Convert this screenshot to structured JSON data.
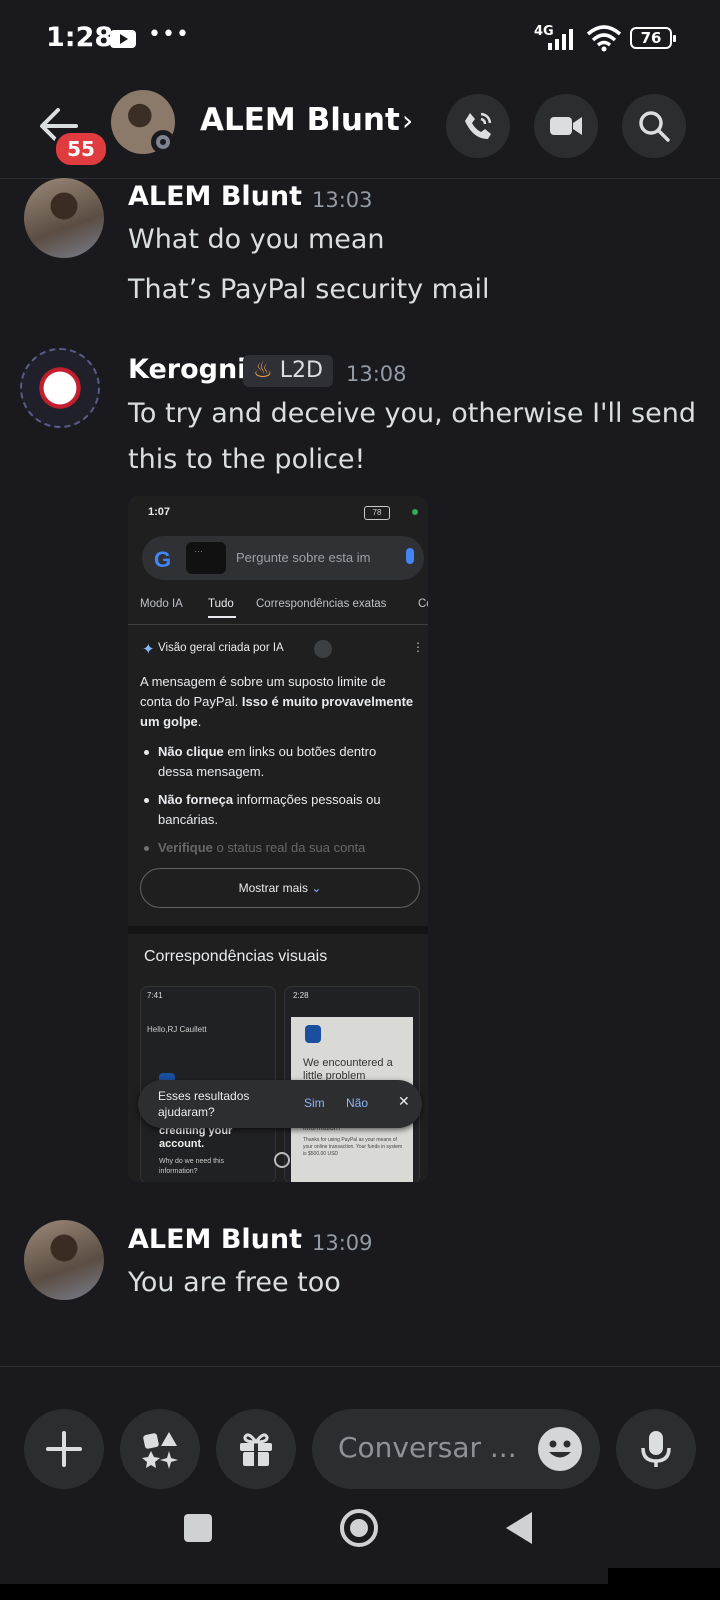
{
  "status_bar": {
    "time": "1:28",
    "dots": "•••",
    "network": "4G",
    "battery": "76"
  },
  "header": {
    "unread_badge": "55",
    "contact_name": "ALEM Blunt",
    "chevron": "›"
  },
  "messages": [
    {
      "author": "ALEM Blunt",
      "time": "13:03",
      "lines": [
        "What do you mean",
        "That’s PayPal security mail"
      ]
    },
    {
      "author": "Kerogni",
      "tag": "L2D",
      "time": "13:08",
      "lines": [
        "To try and deceive you, otherwise I'll send",
        "this to the police!"
      ]
    },
    {
      "author": "ALEM Blunt",
      "time": "13:09",
      "lines": [
        "You are free too"
      ]
    }
  ],
  "attachment": {
    "status_time": "1:07",
    "status_battery": "78",
    "thumb_text": "…",
    "search_placeholder": "Pergunte sobre esta im",
    "tabs": [
      "Modo IA",
      "Tudo",
      "Correspondências exatas",
      "Co"
    ],
    "ai_header": "Visão geral criada por IA",
    "ai_para_plain": "A mensagem é sobre um suposto limite de conta do PayPal. ",
    "ai_para_bold": "Isso é muito provavelmente um golpe",
    "ai_para_end": ".",
    "bullets": [
      {
        "bold": "Não clique",
        "text": " em links ou botões dentro dessa mensagem."
      },
      {
        "bold": "Não forneça",
        "text": " informações pessoais ou bancárias."
      },
      {
        "bold": "Verifique",
        "text": " o status real da sua conta"
      }
    ],
    "show_more": "Mostrar mais",
    "visual_title": "Correspondências visuais",
    "card1_time": "7:41",
    "card1_greeting": "Hello,RJ Caullett",
    "card1_heading": "crediting your account.",
    "card1_sub": "Why do we need this information?",
    "card2_time": "2:28",
    "card2_heading": "We encountered a little problem",
    "card2_sub": "information?",
    "card2_body": "Thanks for using PayPal as your means of your online transaction. Your funds in system is $500.00 USD",
    "toast_question": "Esses resultados ajudaram?",
    "toast_yes": "Sim",
    "toast_no": "Não"
  },
  "input": {
    "placeholder": "Conversar ..."
  }
}
